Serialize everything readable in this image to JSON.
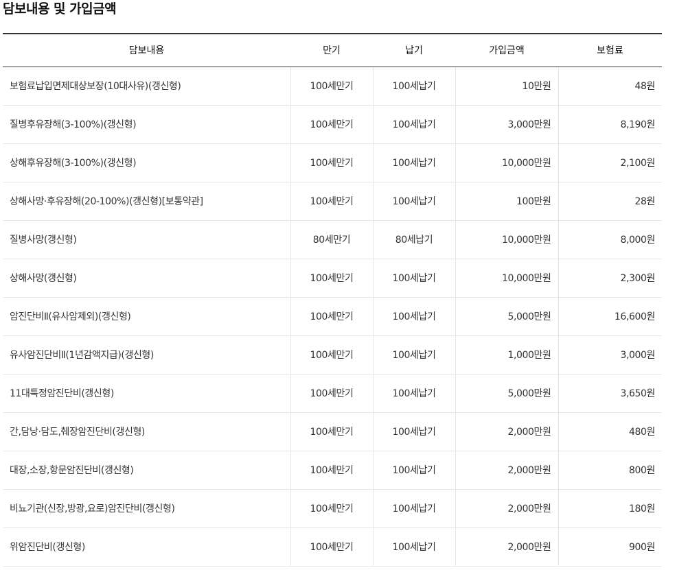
{
  "title": "담보내용 및 가입금액",
  "table": {
    "headers": [
      "담보내용",
      "만기",
      "납기",
      "가입금액",
      "보험료"
    ],
    "rows": [
      [
        "보험료납입면제대상보장(10대사유)(갱신형)",
        "100세만기",
        "100세납기",
        "10만원",
        "48원"
      ],
      [
        "질병후유장해(3-100%)(갱신형)",
        "100세만기",
        "100세납기",
        "3,000만원",
        "8,190원"
      ],
      [
        "상해후유장해(3-100%)(갱신형)",
        "100세만기",
        "100세납기",
        "10,000만원",
        "2,100원"
      ],
      [
        "상해사망·후유장해(20-100%)(갱신형)[보통약관]",
        "100세만기",
        "100세납기",
        "100만원",
        "28원"
      ],
      [
        "질병사망(갱신형)",
        "80세만기",
        "80세납기",
        "10,000만원",
        "8,000원"
      ],
      [
        "상해사망(갱신형)",
        "100세만기",
        "100세납기",
        "10,000만원",
        "2,300원"
      ],
      [
        "암진단비Ⅱ(유사암제외)(갱신형)",
        "100세만기",
        "100세납기",
        "5,000만원",
        "16,600원"
      ],
      [
        "유사암진단비Ⅱ(1년감액지급)(갱신형)",
        "100세만기",
        "100세납기",
        "1,000만원",
        "3,000원"
      ],
      [
        "11대특정암진단비(갱신형)",
        "100세만기",
        "100세납기",
        "5,000만원",
        "3,650원"
      ],
      [
        "간,담낭·담도,췌장암진단비(갱신형)",
        "100세만기",
        "100세납기",
        "2,000만원",
        "480원"
      ],
      [
        "대장,소장,항문암진단비(갱신형)",
        "100세만기",
        "100세납기",
        "2,000만원",
        "800원"
      ],
      [
        "비뇨기관(신장,방광,요로)암진단비(갱신형)",
        "100세만기",
        "100세납기",
        "2,000만원",
        "180원"
      ],
      [
        "위암진단비(갱신형)",
        "100세만기",
        "100세납기",
        "2,000만원",
        "900원"
      ]
    ]
  }
}
